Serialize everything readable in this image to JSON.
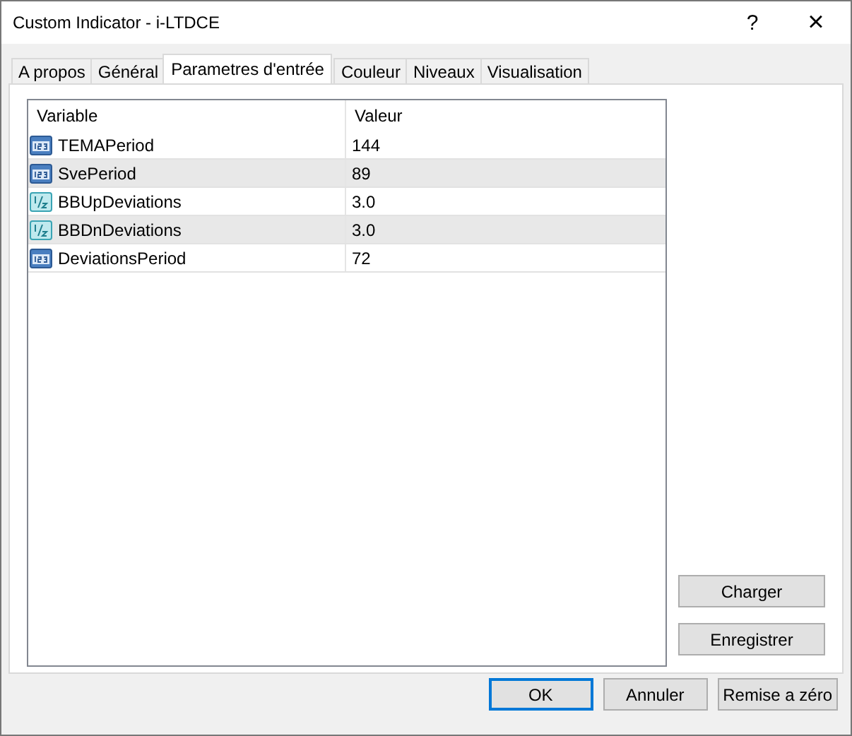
{
  "window": {
    "title": "Custom Indicator - i-LTDCE",
    "help": "?",
    "close": "×"
  },
  "tabs": [
    {
      "label": "A propos",
      "selected": false
    },
    {
      "label": "Général",
      "selected": false
    },
    {
      "label": "Parametres d'entrée",
      "selected": true
    },
    {
      "label": "Couleur",
      "selected": false
    },
    {
      "label": "Niveaux",
      "selected": false
    },
    {
      "label": "Visualisation",
      "selected": false
    }
  ],
  "table": {
    "columns": [
      "Variable",
      "Valeur"
    ],
    "rows": [
      {
        "kind": "int",
        "variable": "TEMAPeriod",
        "value": "144"
      },
      {
        "kind": "int",
        "variable": "SvePeriod",
        "value": "89"
      },
      {
        "kind": "double",
        "variable": "BBUpDeviations",
        "value": "3.0"
      },
      {
        "kind": "double",
        "variable": "BBDnDeviations",
        "value": "3.0"
      },
      {
        "kind": "int",
        "variable": "DeviationsPeriod",
        "value": "72"
      }
    ]
  },
  "side_buttons": [
    "Charger",
    "Enregistrer"
  ],
  "buttons": [
    {
      "label": "OK",
      "default": true
    },
    {
      "label": "Annuler",
      "default": false
    },
    {
      "label": "Remise a zéro",
      "default": false
    }
  ]
}
